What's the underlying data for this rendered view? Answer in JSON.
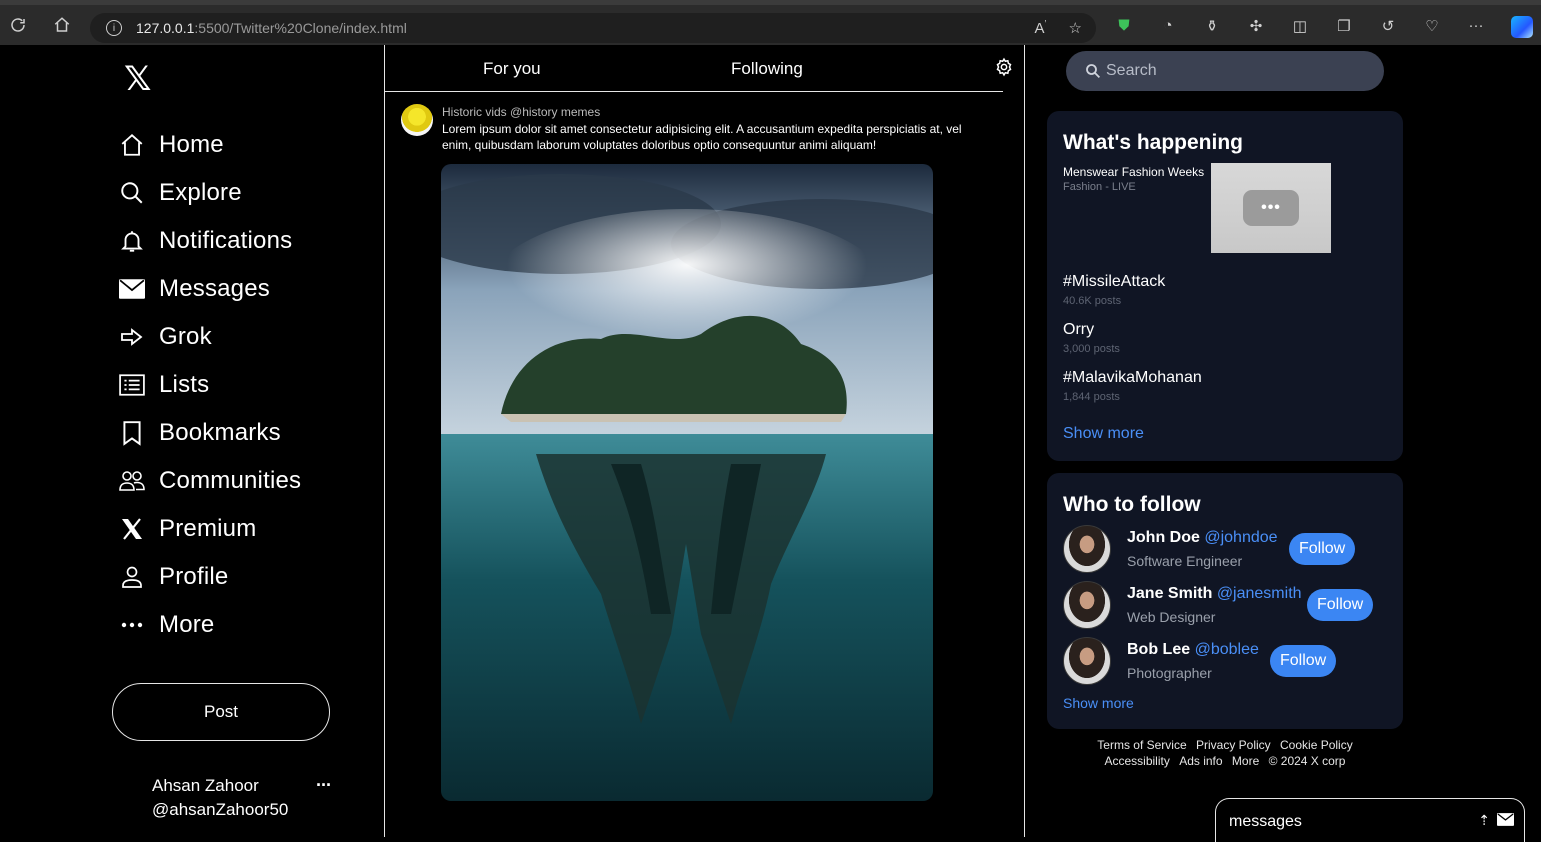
{
  "browser": {
    "url_host": "127.0.0.1",
    "url_path": ":5500/Twitter%20Clone/index.html",
    "icons": [
      "refresh-icon",
      "home-icon",
      "info-icon",
      "read-aloud-icon",
      "favorite-star-icon",
      "shield-extension-icon",
      "glasses-extension-icon",
      "flask-extension-icon",
      "puzzle-icon",
      "split-screen-icon",
      "collections-icon",
      "history-icon",
      "health-icon",
      "more-icon",
      "copilot-icon"
    ]
  },
  "sidebar": {
    "logo": "𝕏",
    "items": [
      {
        "label": "Home",
        "icon": "home-icon"
      },
      {
        "label": "Explore",
        "icon": "search-icon"
      },
      {
        "label": "Notifications",
        "icon": "bell-icon"
      },
      {
        "label": "Messages",
        "icon": "envelope-icon"
      },
      {
        "label": "Grok",
        "icon": "arrow-icon"
      },
      {
        "label": "Lists",
        "icon": "list-icon"
      },
      {
        "label": "Bookmarks",
        "icon": "bookmark-icon"
      },
      {
        "label": "Communities",
        "icon": "people-icon"
      },
      {
        "label": "Premium",
        "icon": "x-icon"
      },
      {
        "label": "Profile",
        "icon": "user-icon"
      },
      {
        "label": "More",
        "icon": "ellipsis-icon"
      }
    ],
    "post_label": "Post",
    "account_name": "Ahsan Zahoor",
    "account_handle": "@ahsanZahoor50",
    "account_more": "···"
  },
  "center": {
    "tabs": [
      "For you",
      "Following"
    ],
    "tweet": {
      "header": "Historic vids @history memes",
      "text": "Lorem ipsum dolor sit amet consectetur adipisicing elit. A accusantium expedita perspiciatis at, vel enim, quibusdam laborum voluptates doloribus optio consequuntur animi aliquam!"
    }
  },
  "right": {
    "search_placeholder": "Search",
    "happening": {
      "title": "What's happening",
      "featured_title": "Menswear Fashion Weeks",
      "featured_sub": "Fashion - LIVE",
      "thumb_glyph": "•••",
      "trends": [
        {
          "tag": "#MissileAttack",
          "posts": "40.6K posts"
        },
        {
          "tag": "Orry",
          "posts": "3,000 posts"
        },
        {
          "tag": "#MalavikaMohanan",
          "posts": "1,844 posts"
        }
      ],
      "show_more": "Show more"
    },
    "follow": {
      "title": "Who to follow",
      "people": [
        {
          "name": "John Doe",
          "handle": "@johndoe",
          "role": "Software Engineer",
          "btn": "Follow"
        },
        {
          "name": "Jane Smith",
          "handle": "@janesmith",
          "role": "Web Designer",
          "btn": "Follow"
        },
        {
          "name": "Bob Lee",
          "handle": "@boblee",
          "role": "Photographer",
          "btn": "Follow"
        }
      ],
      "show_more": "Show more"
    },
    "footer_line1": [
      "Terms of Service",
      "Privacy Policy",
      "Cookie Policy"
    ],
    "footer_line2": [
      "Accessibility",
      "Ads info",
      "More",
      "© 2024 X corp"
    ],
    "messages_label": "messages",
    "messages_expand": "⇡"
  }
}
